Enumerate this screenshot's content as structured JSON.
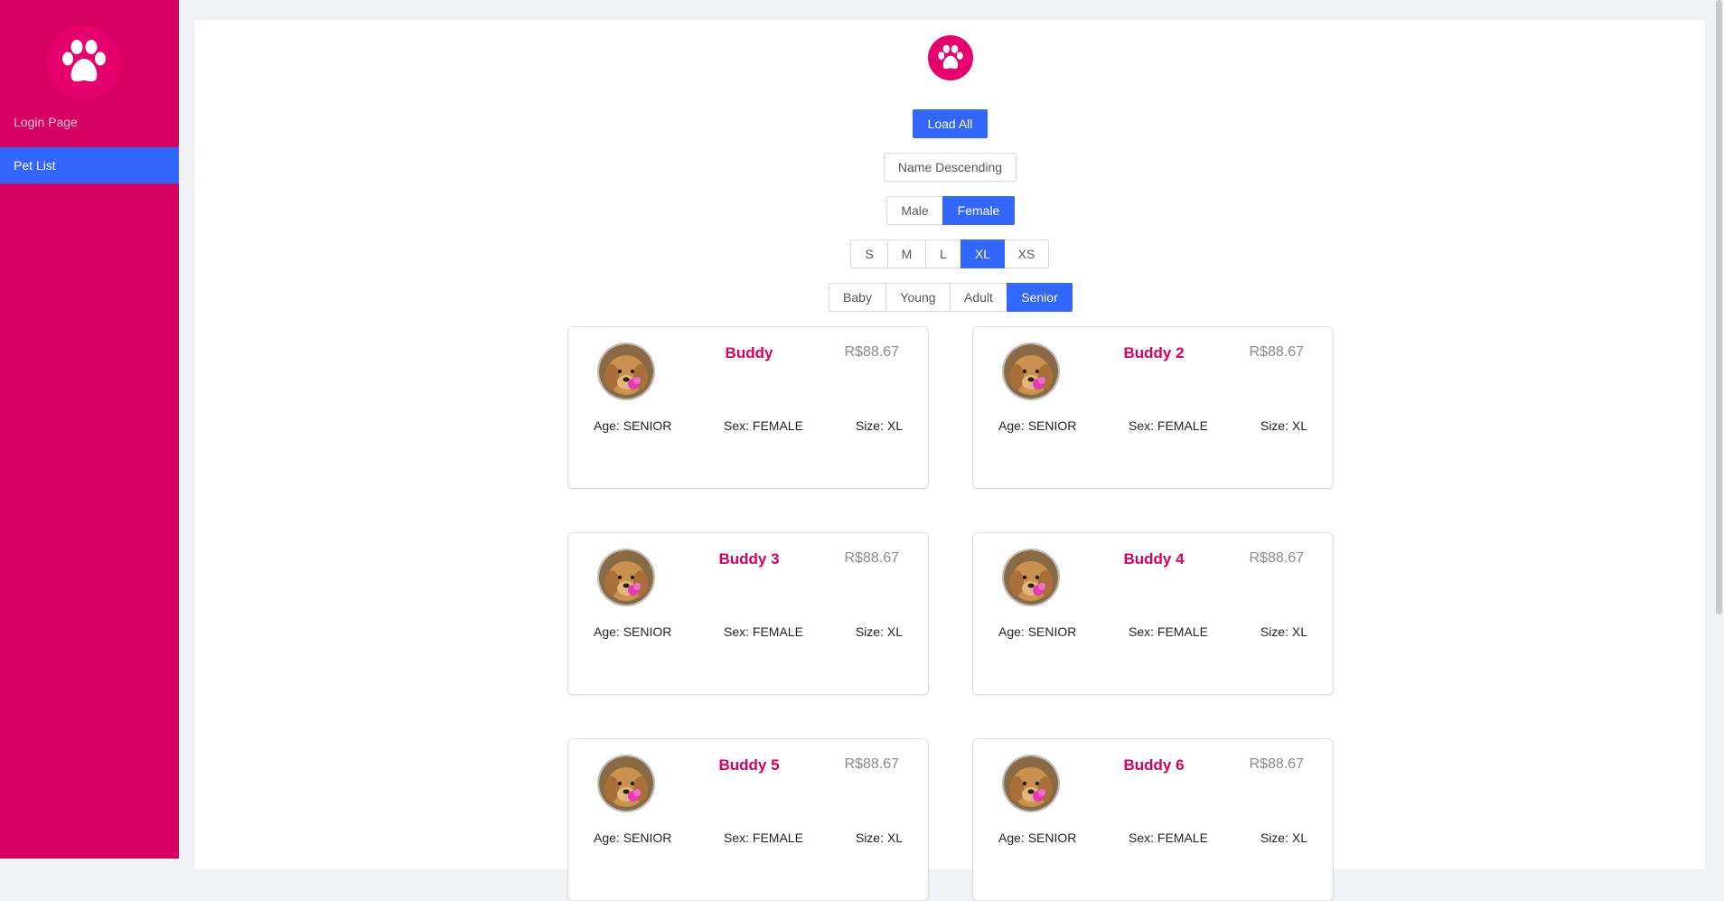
{
  "sidebar": {
    "login_label": "Login Page",
    "menu": [
      {
        "label": "Pet List",
        "active": true
      }
    ]
  },
  "toolbar": {
    "load_all_label": "Load All",
    "sort_label": "Name Descending",
    "sex_options": [
      {
        "label": "Male",
        "active": false
      },
      {
        "label": "Female",
        "active": true
      }
    ],
    "size_options": [
      {
        "label": "S",
        "active": false
      },
      {
        "label": "M",
        "active": false
      },
      {
        "label": "L",
        "active": false
      },
      {
        "label": "XL",
        "active": true
      },
      {
        "label": "XS",
        "active": false
      }
    ],
    "age_options": [
      {
        "label": "Baby",
        "active": false
      },
      {
        "label": "Young",
        "active": false
      },
      {
        "label": "Adult",
        "active": false
      },
      {
        "label": "Senior",
        "active": true
      }
    ]
  },
  "pets": [
    {
      "name": "Buddy",
      "price": "R$88.67",
      "age": "Age: SENIOR",
      "sex": "Sex: FEMALE",
      "size": "Size: XL"
    },
    {
      "name": "Buddy 2",
      "price": "R$88.67",
      "age": "Age: SENIOR",
      "sex": "Sex: FEMALE",
      "size": "Size: XL"
    },
    {
      "name": "Buddy 3",
      "price": "R$88.67",
      "age": "Age: SENIOR",
      "sex": "Sex: FEMALE",
      "size": "Size: XL"
    },
    {
      "name": "Buddy 4",
      "price": "R$88.67",
      "age": "Age: SENIOR",
      "sex": "Sex: FEMALE",
      "size": "Size: XL"
    },
    {
      "name": "Buddy 5",
      "price": "R$88.67",
      "age": "Age: SENIOR",
      "sex": "Sex: FEMALE",
      "size": "Size: XL"
    },
    {
      "name": "Buddy 6",
      "price": "R$88.67",
      "age": "Age: SENIOR",
      "sex": "Sex: FEMALE",
      "size": "Size: XL"
    }
  ],
  "colors": {
    "brand": "#d60062",
    "accent": "#3366ff",
    "logo_bg": "#e5006c"
  },
  "icons": {
    "logo": "paw-icon",
    "pet_photo": "dog-photo"
  }
}
